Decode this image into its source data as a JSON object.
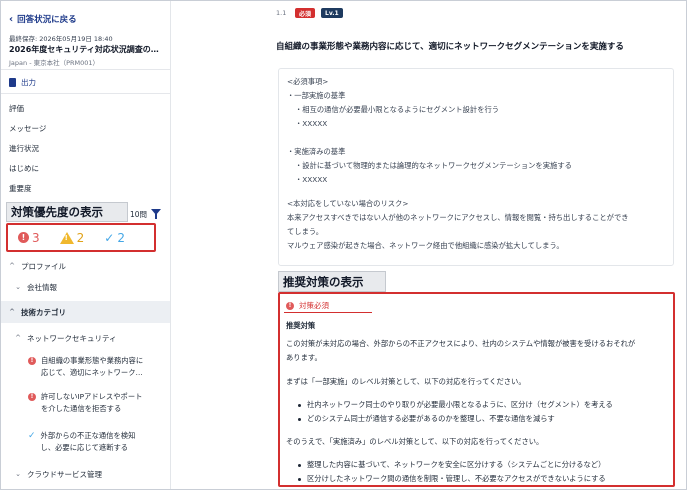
{
  "sidebar": {
    "back_label": "回答状況に戻る",
    "saved_at": "最終保存: 2026年05月19日 18:40",
    "doc_title": "2026年度セキュリティ対応状況調査の…",
    "doc_subtitle": "Japan - 東京本社（PRM001）",
    "export_label": "出力",
    "nav_items": [
      "評価",
      "メッセージ",
      "進行状況",
      "はじめに",
      "重要度"
    ],
    "priority_callout": "対策優先度の表示",
    "question_count": "10問",
    "priority_counts": {
      "error": "3",
      "warning": "2",
      "ok": "2"
    },
    "tree": {
      "profile": "プロファイル",
      "company_info": "会社情報",
      "tech_category": "技術カテゴリ",
      "network_security": "ネットワークセキュリティ",
      "leaf1": [
        "自組織の事業形態や業務内容に",
        "応じて、適切にネットワーク…"
      ],
      "leaf2": [
        "許可しないIPアドレスやポート",
        "を介した通信を拒否する"
      ],
      "leaf3": [
        "外部からの不正な通信を検知",
        "し、必要に応じて遮断する"
      ],
      "cloud_service": "クラウドサービス管理"
    }
  },
  "main": {
    "question_number": "1.1",
    "badge_required": "必須",
    "badge_level": "Lv.1",
    "question_title": "自組織の事業形態や業務内容に応じて、適切にネットワークセグメンテーションを実施する",
    "requirements": [
      "<必須事項>",
      "・一部実施の基準",
      "・相互の通信が必要最小限となるようにセグメント設計を行う",
      "・XXXXX",
      "・実施済みの基準",
      "・設計に基づいて物理的または論理的なネットワークセグメンテーションを実施する",
      "・XXXXX",
      "<本対応をしていない場合のリスク>",
      "本来アクセスすべきではない人が他のネットワークにアクセスし、情報を閲覧・持ち出しすることができ",
      "てしまう。",
      "マルウェア感染が起きた場合、ネットワーク経由で他組織に感染が拡大してしまう。"
    ],
    "recommend_callout": "推奨対策の表示",
    "recommend": {
      "tag": "対策必須",
      "heading": "推奨対策",
      "p1": [
        "この対策が未対応の場合、外部からの不正アクセスにより、社内のシステムや情報が被害を受けるおそれが",
        "あります。"
      ],
      "p2": "まずは「一部実施」のレベル対策として、以下の対応を行ってください。",
      "bullets1": [
        "社内ネットワーク同士のやり取りが必要最小限となるように、区分け（セグメント）を考える",
        "どのシステム同士が通信する必要があるのかを整理し、不要な通信を減らす"
      ],
      "p3": "そのうえで、「実施済み」のレベル対策として、以下の対応を行ってください。",
      "bullets2": [
        "整理した内容に基づいて、ネットワークを安全に区分けする（システムごとに分けるなど）",
        "区分けしたネットワーク間の通信を制限・管理し、不必要なアクセスができないようにする"
      ]
    }
  },
  "colors": {
    "accent": "#1e3a8a",
    "error": "#e05a5a",
    "warning": "#f0b82d",
    "ok": "#45a7e6",
    "highlight": "#d32f2f"
  }
}
